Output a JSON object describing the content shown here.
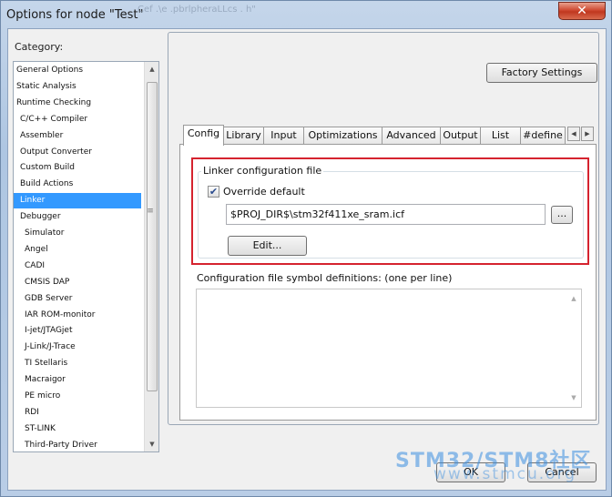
{
  "window": {
    "title": "Options for node \"Test\"",
    "title_ghost": "Cef .\\e .pbrlpheraLLcs . h\"",
    "close_glyph": "✕"
  },
  "category": {
    "label": "Category:",
    "items": [
      {
        "label": "General Options",
        "indent": 0
      },
      {
        "label": "Static Analysis",
        "indent": 0
      },
      {
        "label": "Runtime Checking",
        "indent": 0
      },
      {
        "label": "C/C++ Compiler",
        "indent": 1
      },
      {
        "label": "Assembler",
        "indent": 1
      },
      {
        "label": "Output Converter",
        "indent": 1
      },
      {
        "label": "Custom Build",
        "indent": 1
      },
      {
        "label": "Build Actions",
        "indent": 1
      },
      {
        "label": "Linker",
        "indent": 1,
        "selected": true
      },
      {
        "label": "Debugger",
        "indent": 1
      },
      {
        "label": "Simulator",
        "indent": 2
      },
      {
        "label": "Angel",
        "indent": 2
      },
      {
        "label": "CADI",
        "indent": 2
      },
      {
        "label": "CMSIS DAP",
        "indent": 2
      },
      {
        "label": "GDB Server",
        "indent": 2
      },
      {
        "label": "IAR ROM-monitor",
        "indent": 2
      },
      {
        "label": "I-jet/JTAGjet",
        "indent": 2
      },
      {
        "label": "J-Link/J-Trace",
        "indent": 2
      },
      {
        "label": "TI Stellaris",
        "indent": 2
      },
      {
        "label": "Macraigor",
        "indent": 2
      },
      {
        "label": "PE micro",
        "indent": 2
      },
      {
        "label": "RDI",
        "indent": 2
      },
      {
        "label": "ST-LINK",
        "indent": 2
      },
      {
        "label": "Third-Party Driver",
        "indent": 2
      }
    ]
  },
  "factory_settings_label": "Factory Settings",
  "tabs": [
    "Config",
    "Library",
    "Input",
    "Optimizations",
    "Advanced",
    "Output",
    "List",
    "#define"
  ],
  "active_tab": "Config",
  "linker_config": {
    "group_title": "Linker configuration file",
    "override_label": "Override default",
    "override_checked": true,
    "check_glyph": "✔",
    "path_value": "$PROJ_DIR$\\stm32f411xe_sram.icf",
    "browse_label": "...",
    "edit_label": "Edit..."
  },
  "defs_label": "Configuration file symbol definitions: (one per line)",
  "ok_label": "OK",
  "cancel_label": "Cancel",
  "watermark": {
    "line1": "STM32/STM8社区",
    "line2": "www.stmcu.org"
  },
  "colors": {
    "selection": "#3399ff",
    "highlight_box": "#d5232f"
  }
}
